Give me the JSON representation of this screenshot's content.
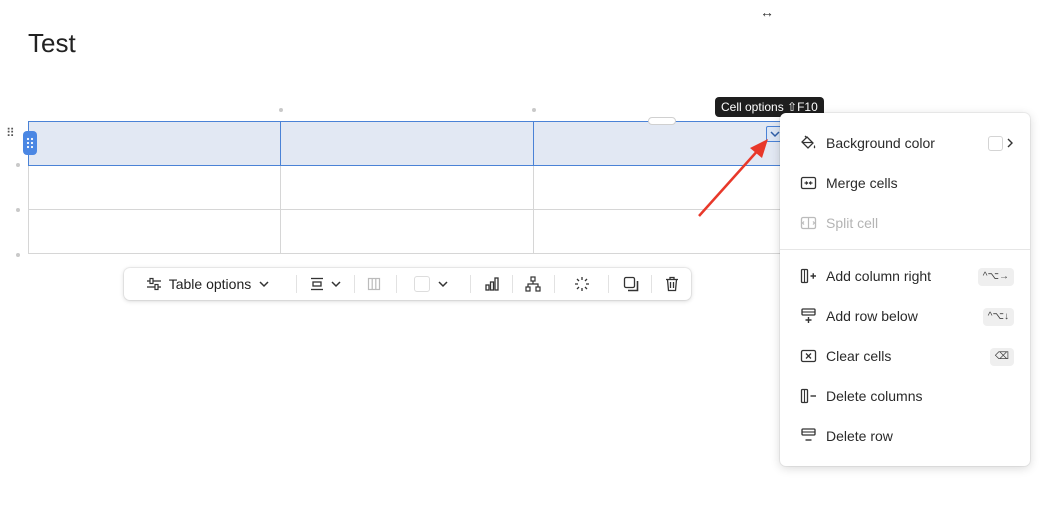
{
  "page": {
    "title": "Test",
    "resize_hint": "↔"
  },
  "tooltip": {
    "text": "Cell options ⇧F10"
  },
  "toolbar": {
    "table_options_label": "Table options"
  },
  "menu": {
    "background_color": "Background color",
    "merge_cells": "Merge cells",
    "split_cell": "Split cell",
    "add_column_right": {
      "label": "Add column right",
      "shortcut": "^⌥→"
    },
    "add_row_below": {
      "label": "Add row below",
      "shortcut": "^⌥↓"
    },
    "clear_cells": {
      "label": "Clear cells",
      "shortcut": "⌫"
    },
    "delete_columns": "Delete columns",
    "delete_row": "Delete row"
  },
  "colors": {
    "accent": "#4b87e3",
    "selection": "#e2e8f3",
    "arrow": "#e8382a"
  }
}
